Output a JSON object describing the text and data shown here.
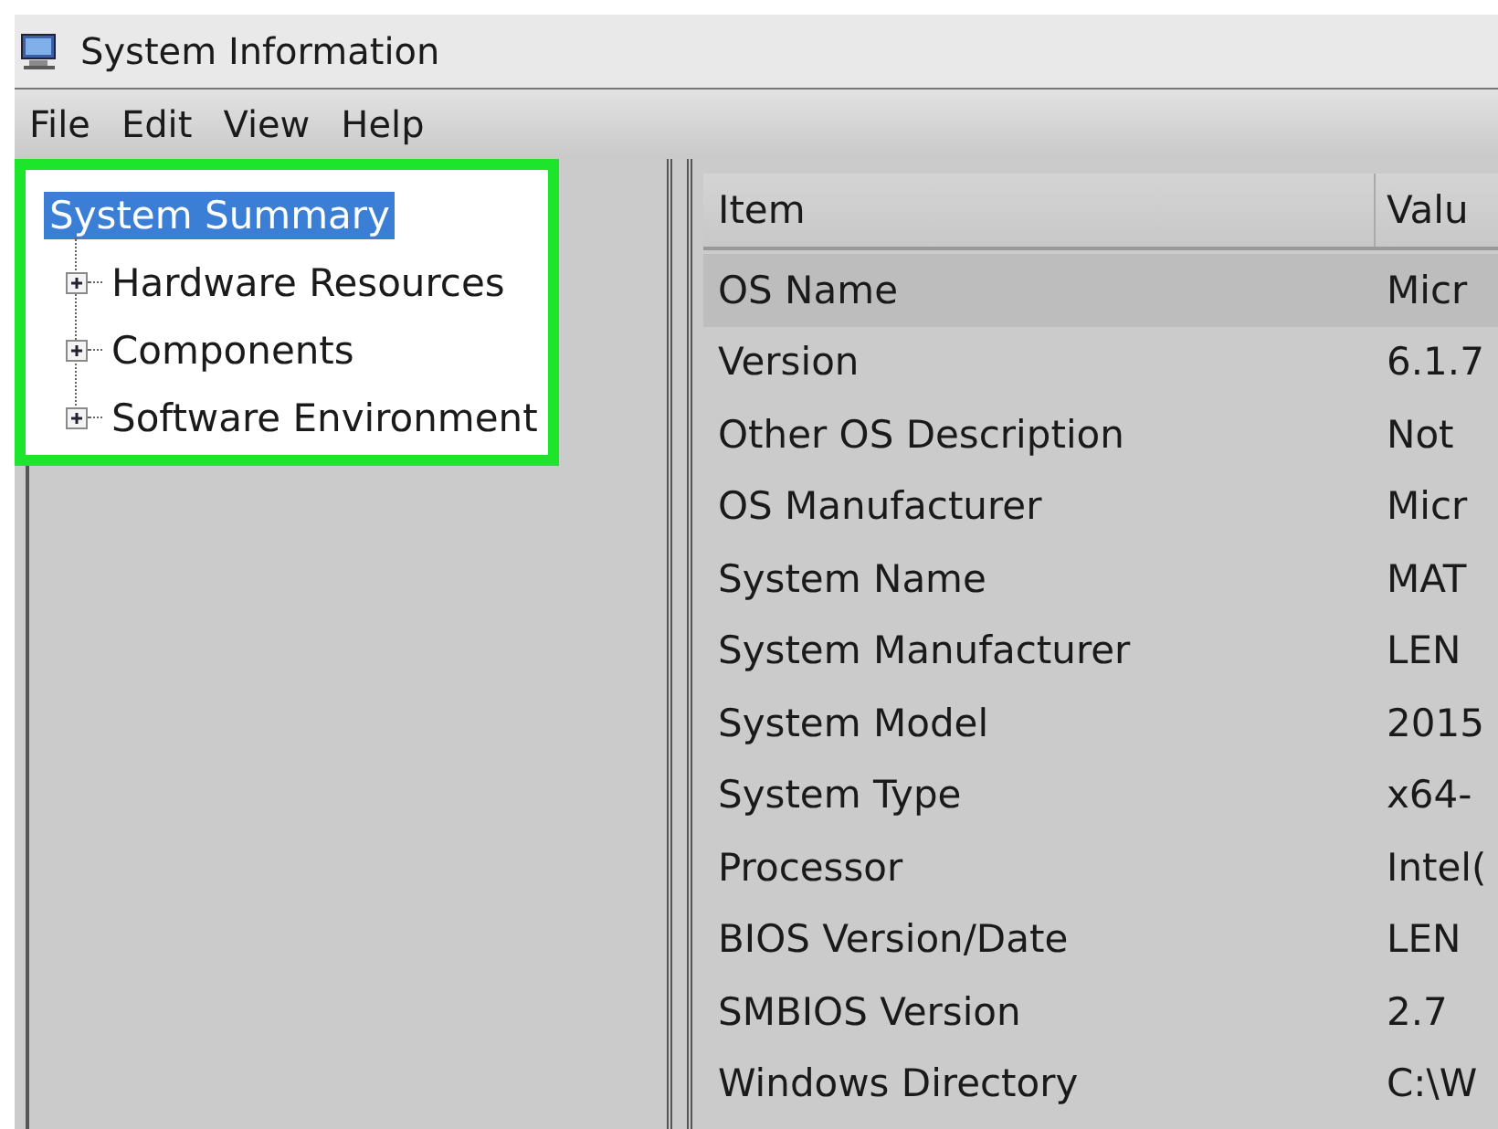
{
  "window": {
    "title": "System Information"
  },
  "menu": [
    "File",
    "Edit",
    "View",
    "Help"
  ],
  "tree": {
    "items": [
      {
        "label": "System Summary",
        "selected": true,
        "children": [
          {
            "label": "Hardware Resources",
            "selected": false,
            "expanded": false
          },
          {
            "label": "Components",
            "selected": false,
            "expanded": false
          },
          {
            "label": "Software Environment",
            "selected": false,
            "expanded": false
          }
        ]
      }
    ]
  },
  "table": {
    "columns": [
      "Item",
      "Valu"
    ],
    "rows": [
      {
        "cells": [
          "OS Name",
          "Micr"
        ],
        "selected": true
      },
      {
        "cells": [
          "Version",
          "6.1.7"
        ],
        "selected": false
      },
      {
        "cells": [
          "Other OS Description",
          "Not"
        ],
        "selected": false
      },
      {
        "cells": [
          "OS Manufacturer",
          "Micr"
        ],
        "selected": false
      },
      {
        "cells": [
          "System Name",
          "MAT"
        ],
        "selected": false
      },
      {
        "cells": [
          "System Manufacturer",
          "LEN"
        ],
        "selected": false
      },
      {
        "cells": [
          "System Model",
          "2015"
        ],
        "selected": false
      },
      {
        "cells": [
          "System Type",
          "x64-"
        ],
        "selected": false
      },
      {
        "cells": [
          "Processor",
          "Intel("
        ],
        "selected": false
      },
      {
        "cells": [
          "BIOS Version/Date",
          "LEN"
        ],
        "selected": false
      },
      {
        "cells": [
          "SMBIOS Version",
          "2.7"
        ],
        "selected": false
      },
      {
        "cells": [
          "Windows Directory",
          "C:\\W"
        ],
        "selected": false
      }
    ]
  }
}
